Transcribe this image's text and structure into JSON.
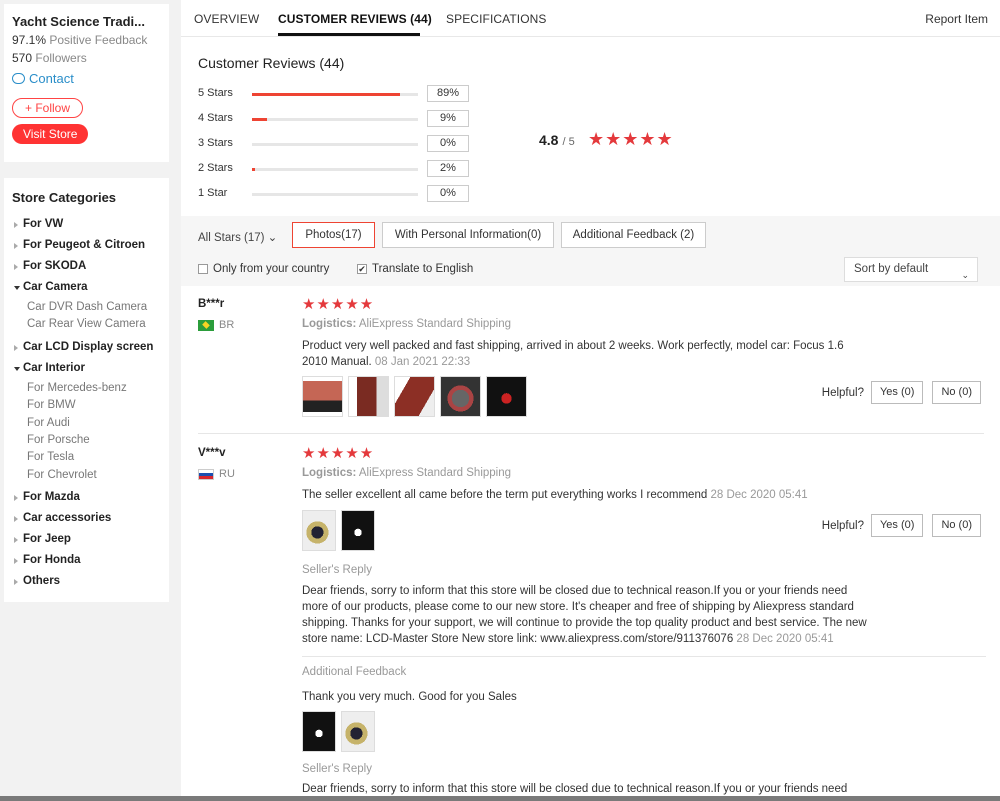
{
  "store": {
    "name": "Yacht Science Tradi...",
    "feedback_value": "97.1%",
    "feedback_label": "Positive Feedback",
    "followers_value": "570",
    "followers_label": "Followers",
    "contact_label": "Contact",
    "follow_label": "+ Follow",
    "visit_label": "Visit Store"
  },
  "categories": {
    "title": "Store Categories",
    "items": [
      {
        "label": "For VW"
      },
      {
        "label": "For Peugeot & Citroen"
      },
      {
        "label": "For SKODA"
      },
      {
        "label": "Car Camera"
      },
      {
        "label": "Car DVR Dash Camera"
      },
      {
        "label": "Car Rear View Camera"
      },
      {
        "label": "Car LCD Display screen"
      },
      {
        "label": "Car Interior"
      },
      {
        "label": "For Mercedes-benz"
      },
      {
        "label": "For BMW"
      },
      {
        "label": "For Audi"
      },
      {
        "label": "For Porsche"
      },
      {
        "label": "For Tesla"
      },
      {
        "label": "For Chevrolet"
      },
      {
        "label": "For Mazda"
      },
      {
        "label": "Car accessories"
      },
      {
        "label": "For Jeep"
      },
      {
        "label": "For Honda"
      },
      {
        "label": "Others"
      }
    ]
  },
  "tabs": {
    "overview": "OVERVIEW",
    "reviews": "CUSTOMER REVIEWS (44)",
    "specs": "SPECIFICATIONS",
    "report": "Report Item"
  },
  "summary": {
    "title": "Customer Reviews (44)",
    "rows": [
      {
        "label": "5 Stars",
        "pct": "89%",
        "fraction": 0.89
      },
      {
        "label": "4 Stars",
        "pct": "9%",
        "fraction": 0.09
      },
      {
        "label": "3 Stars",
        "pct": "0%",
        "fraction": 0
      },
      {
        "label": "2 Stars",
        "pct": "2%",
        "fraction": 0.02
      },
      {
        "label": "1 Star",
        "pct": "0%",
        "fraction": 0
      }
    ],
    "rating": "4.8",
    "rating_max": "/ 5",
    "rating_stars": 5
  },
  "filters": {
    "all_stars": "All Stars (17)",
    "photos": "Photos(17)",
    "personal": "With Personal Information(0)",
    "additional": "Additional Feedback (2)",
    "only_country": "Only from your country",
    "translate": "Translate to English",
    "translate_checked": true,
    "sort": "Sort by default"
  },
  "reviews": [
    {
      "user": "B***r",
      "country": "BR",
      "stars": 5,
      "logistics_label": "Logistics:",
      "logistics": "AliExpress Standard Shipping",
      "text": "Product very well packed and fast shipping, arrived in about 2 weeks. Work perfectly, model car: Focus 1.6 2010 Manual.",
      "date": "08 Jan 2021 22:33",
      "photos": 5,
      "helpful_label": "Helpful?",
      "yes": "Yes (0)",
      "no": "No (0)"
    },
    {
      "user": "V***v",
      "country": "RU",
      "stars": 5,
      "logistics_label": "Logistics:",
      "logistics": "AliExpress Standard Shipping",
      "text": "The seller excellent all came before the term put everything works I recommend",
      "date": "28 Dec 2020 05:41",
      "photos": 2,
      "helpful_label": "Helpful?",
      "yes": "Yes (0)",
      "no": "No (0)",
      "seller_reply_label": "Seller's Reply",
      "seller_reply": "Dear friends, sorry to inform that this store will be closed due to technical reason.If you or your friends need more of our products, please come to our new store. It's cheaper and free of shipping by Aliexpress standard shipping. Thanks for your support, we will continue to provide the top quality product and best service. The new store name: LCD-Master Store New store link: www.aliexpress.com/store/911376076",
      "seller_reply_date": "28 Dec 2020 05:41",
      "additional_label": "Additional Feedback",
      "additional_text": "Thank you very much. Good for you Sales",
      "seller_reply2_label": "Seller's Reply",
      "seller_reply2": "Dear friends, sorry to inform that this store will be closed due to technical reason.If you or your friends need"
    }
  ],
  "colors": {
    "accent": "#e4393c",
    "link": "#2a8ec9"
  }
}
